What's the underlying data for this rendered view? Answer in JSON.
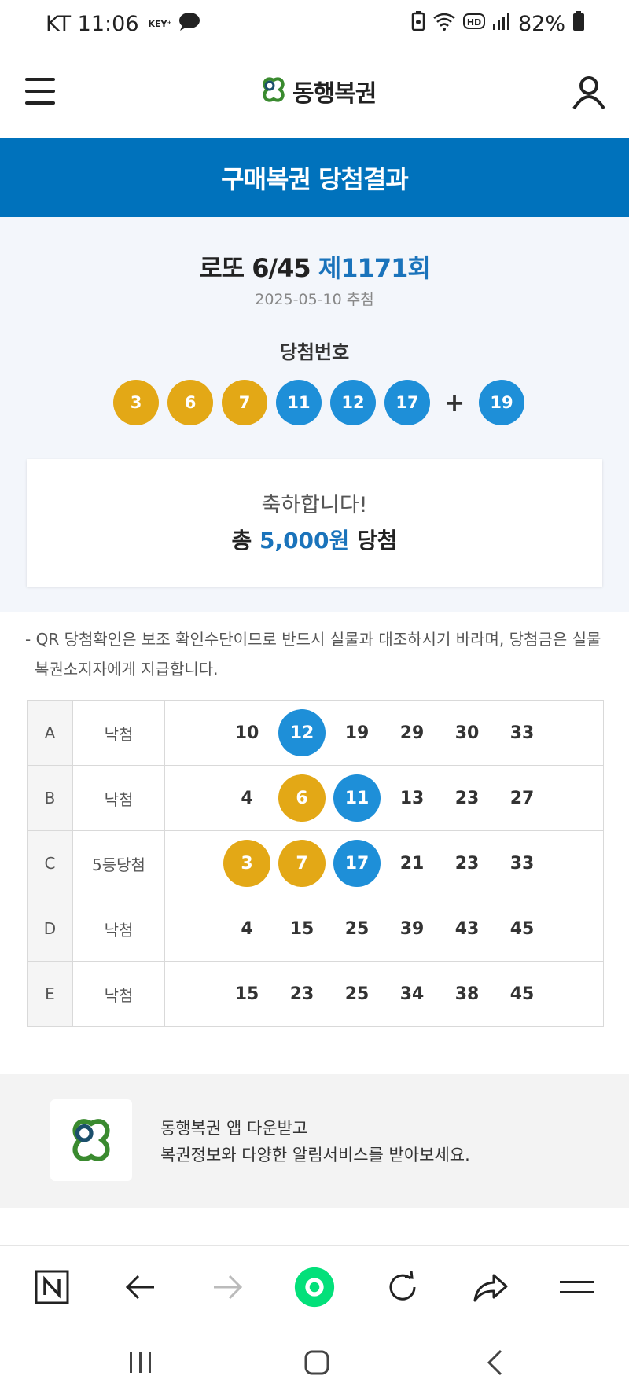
{
  "status_bar": {
    "carrier_time": "KT 11:06",
    "key_label": "KEY⁺",
    "battery": "82%",
    "hd_label": "HD"
  },
  "header": {
    "logo_text": "동행복권"
  },
  "banner": {
    "title": "구매복권 당첨결과"
  },
  "draw": {
    "game": "로또 6/45",
    "round": "제1171회",
    "date": "2025-05-10 추첨",
    "winning_label": "당첨번호",
    "winning_numbers": [
      "3",
      "6",
      "7",
      "11",
      "12",
      "17"
    ],
    "plus": "+",
    "bonus": "19"
  },
  "congrats": {
    "line1": "축하합니다!",
    "prefix": "총",
    "amount": "5,000원",
    "suffix": "당첨"
  },
  "notice": {
    "line1": "- QR 당첨확인은 보조 확인수단이므로 반드시 실물과 대조하시기 바라며, 당첨금은 실물",
    "line2": "복권소지자에게 지급합니다."
  },
  "tickets": [
    {
      "letter": "A",
      "result": "낙첨",
      "numbers": [
        "10",
        "12",
        "19",
        "29",
        "30",
        "33"
      ]
    },
    {
      "letter": "B",
      "result": "낙첨",
      "numbers": [
        "4",
        "6",
        "11",
        "13",
        "23",
        "27"
      ]
    },
    {
      "letter": "C",
      "result": "5등당첨",
      "numbers": [
        "3",
        "7",
        "17",
        "21",
        "23",
        "33"
      ]
    },
    {
      "letter": "D",
      "result": "낙첨",
      "numbers": [
        "4",
        "15",
        "25",
        "39",
        "43",
        "45"
      ]
    },
    {
      "letter": "E",
      "result": "낙첨",
      "numbers": [
        "15",
        "23",
        "25",
        "34",
        "38",
        "45"
      ]
    }
  ],
  "promo": {
    "line1": "동행복권 앱 다운받고",
    "line2": "복권정보와 다양한 알림서비스를 받아보세요."
  },
  "colors": {
    "brand_blue": "#0072bc",
    "ball_yellow": "#e3a816",
    "ball_blue": "#1e8fd8",
    "logo_green": "#3a8a2f"
  }
}
